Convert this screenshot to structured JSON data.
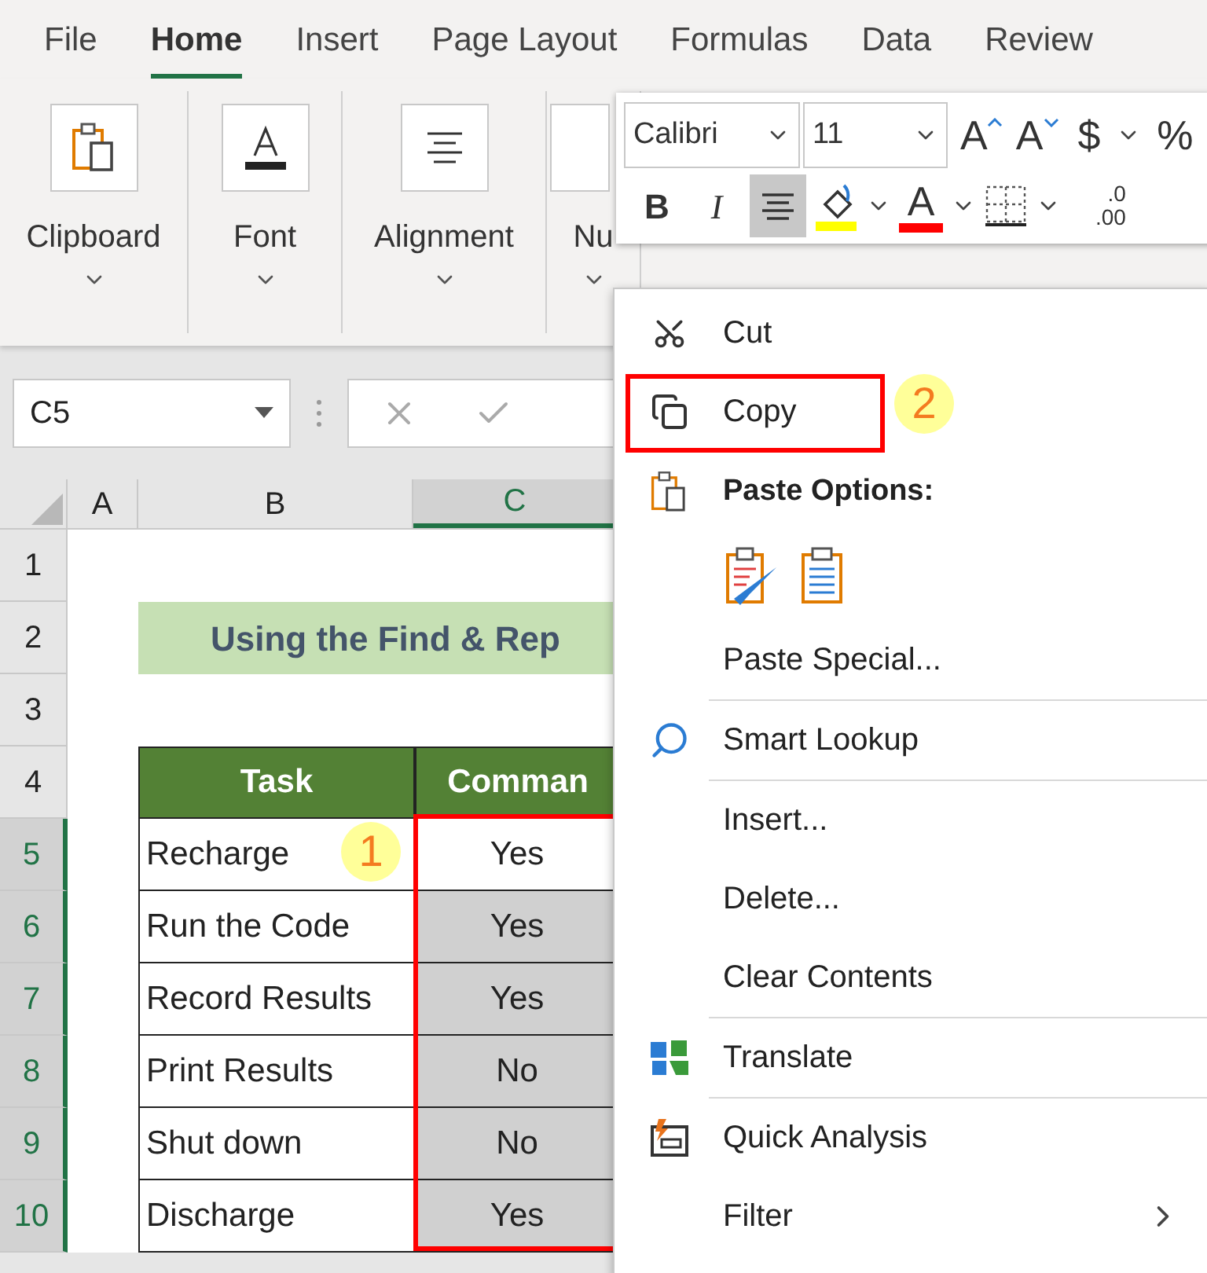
{
  "tabs": [
    {
      "label": "File",
      "selected": false
    },
    {
      "label": "Home",
      "selected": true
    },
    {
      "label": "Insert",
      "selected": false
    },
    {
      "label": "Page Layout",
      "selected": false
    },
    {
      "label": "Formulas",
      "selected": false
    },
    {
      "label": "Data",
      "selected": false
    },
    {
      "label": "Review",
      "selected": false
    }
  ],
  "ribbon_groups": [
    {
      "label": "Clipboard"
    },
    {
      "label": "Font"
    },
    {
      "label": "Alignment"
    },
    {
      "label": "Nu"
    }
  ],
  "mini_toolbar": {
    "font": "Calibri",
    "size": "11",
    "row1": [
      {
        "kind": "grow",
        "glyph": "A"
      },
      {
        "kind": "shrink",
        "glyph": "A"
      },
      {
        "kind": "text",
        "glyph": "$"
      },
      {
        "kind": "caret"
      },
      {
        "kind": "text",
        "glyph": "%"
      }
    ],
    "row2": [
      {
        "kind": "bold",
        "glyph": "B",
        "selected": false
      },
      {
        "kind": "italic",
        "glyph": "I",
        "selected": false
      },
      {
        "kind": "align",
        "selected": true
      },
      {
        "kind": "fill",
        "color": "#ffff00"
      },
      {
        "kind": "caret"
      },
      {
        "kind": "fontcolor",
        "glyph": "A",
        "color": "#ff0000"
      },
      {
        "kind": "caret"
      },
      {
        "kind": "borders"
      },
      {
        "kind": "caret"
      },
      {
        "kind": "decimal",
        "top": ".0",
        "bottom": ".00"
      }
    ]
  },
  "name_box": "C5",
  "columns": [
    {
      "label": "A",
      "selected": false
    },
    {
      "label": "B",
      "selected": false
    },
    {
      "label": "C",
      "selected": true
    }
  ],
  "row_headers": [
    {
      "label": "1",
      "selected": false
    },
    {
      "label": "2",
      "selected": false
    },
    {
      "label": "3",
      "selected": false
    },
    {
      "label": "4",
      "selected": false
    },
    {
      "label": "5",
      "selected": true
    },
    {
      "label": "6",
      "selected": true
    },
    {
      "label": "7",
      "selected": true
    },
    {
      "label": "8",
      "selected": true
    },
    {
      "label": "9",
      "selected": true
    },
    {
      "label": "10",
      "selected": true
    }
  ],
  "title": "Using the Find & Rep",
  "table": {
    "columns": [
      "Task",
      "Comman"
    ],
    "rows": [
      {
        "task": "Recharge",
        "command": "Yes",
        "active": true
      },
      {
        "task": "Run the Code",
        "command": "Yes",
        "active": false
      },
      {
        "task": "Record Results",
        "command": "Yes",
        "active": false
      },
      {
        "task": "Print Results",
        "command": "No",
        "active": false
      },
      {
        "task": "Shut down",
        "command": "No",
        "active": false
      },
      {
        "task": "Discharge",
        "command": "Yes",
        "active": false
      }
    ]
  },
  "markers": [
    "1",
    "2"
  ],
  "context_menu": [
    {
      "kind": "item",
      "label": "Cut",
      "highlighted": false
    },
    {
      "kind": "item",
      "label": "Copy",
      "highlighted": true
    },
    {
      "kind": "header",
      "label": "Paste Options:"
    },
    {
      "kind": "paste_icons"
    },
    {
      "kind": "item",
      "label": "Paste Special...",
      "highlighted": false
    },
    {
      "kind": "separator"
    },
    {
      "kind": "item",
      "label": "Smart Lookup",
      "highlighted": false
    },
    {
      "kind": "separator"
    },
    {
      "kind": "item",
      "label": "Insert...",
      "highlighted": false
    },
    {
      "kind": "item",
      "label": "Delete...",
      "highlighted": false
    },
    {
      "kind": "item",
      "label": "Clear Contents",
      "highlighted": false
    },
    {
      "kind": "separator"
    },
    {
      "kind": "item",
      "label": "Translate",
      "highlighted": false
    },
    {
      "kind": "separator"
    },
    {
      "kind": "item",
      "label": "Quick Analysis",
      "highlighted": false
    },
    {
      "kind": "submenu",
      "label": "Filter",
      "highlighted": false
    }
  ]
}
